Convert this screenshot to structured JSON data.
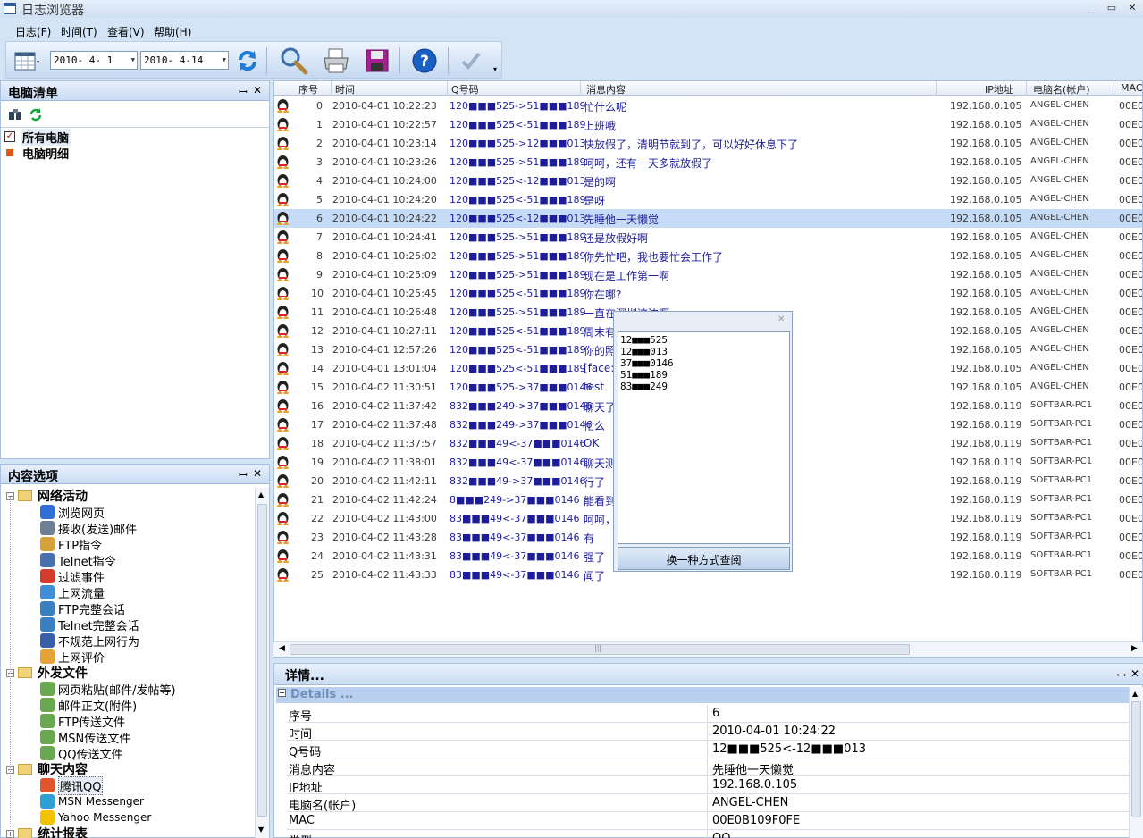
{
  "window": {
    "title": "日志浏览器"
  },
  "menu": [
    "日志(F)",
    "时间(T)",
    "查看(V)",
    "帮助(H)"
  ],
  "toolbar": {
    "date_from": "2010- 4- 1",
    "date_to": "2010- 4-14"
  },
  "pc_panel": {
    "title": "电脑清单",
    "items": [
      "所有电脑",
      "电脑明细"
    ]
  },
  "content_panel": {
    "title": "内容选项",
    "groups": [
      {
        "label": "网络活动",
        "items": [
          "浏览网页",
          "接收(发送)邮件",
          "FTP指令",
          "Telnet指令",
          "过滤事件",
          "上网流量",
          "FTP完整会话",
          "Telnet完整会话",
          "不规范上网行为",
          "上网评价"
        ]
      },
      {
        "label": "外发文件",
        "items": [
          "网页粘贴(邮件/发帖等)",
          "邮件正文(附件)",
          "FTP传送文件",
          "MSN传送文件",
          "QQ传送文件"
        ]
      },
      {
        "label": "聊天内容",
        "items": [
          "腾讯QQ",
          "MSN Messenger",
          "Yahoo Messenger"
        ]
      },
      {
        "label": "统计报表",
        "items": []
      }
    ]
  },
  "grid": {
    "columns": [
      "序号",
      "时间",
      "Q号码",
      "消息内容",
      "IP地址",
      "电脑名(帐户)",
      "MAC"
    ],
    "rows": [
      [
        "0",
        "2010-04-01 10:22:23",
        "120■■■525->51■■■189",
        "忙什么呢",
        "192.168.0.105",
        "ANGEL-CHEN",
        "00E0I"
      ],
      [
        "1",
        "2010-04-01 10:22:57",
        "120■■■525<-51■■■189",
        "上班哦",
        "192.168.0.105",
        "ANGEL-CHEN",
        "00E0I"
      ],
      [
        "2",
        "2010-04-01 10:23:14",
        "120■■■525->12■■■013",
        "快放假了，清明节就到了，可以好好休息下了",
        "192.168.0.105",
        "ANGEL-CHEN",
        "00E0I"
      ],
      [
        "3",
        "2010-04-01 10:23:26",
        "120■■■525->51■■■189",
        "呵呵，还有一天多就放假了",
        "192.168.0.105",
        "ANGEL-CHEN",
        "00E0I"
      ],
      [
        "4",
        "2010-04-01 10:24:00",
        "120■■■525<-12■■■013",
        "是的啊",
        "192.168.0.105",
        "ANGEL-CHEN",
        "00E0I"
      ],
      [
        "5",
        "2010-04-01 10:24:20",
        "120■■■525<-51■■■189",
        "是呀",
        "192.168.0.105",
        "ANGEL-CHEN",
        "00E0I"
      ],
      [
        "6",
        "2010-04-01 10:24:22",
        "120■■■525<-12■■■013",
        "先睡他一天懒觉",
        "192.168.0.105",
        "ANGEL-CHEN",
        "00E0I"
      ],
      [
        "7",
        "2010-04-01 10:24:41",
        "120■■■525->51■■■189",
        "还是放假好啊",
        "192.168.0.105",
        "ANGEL-CHEN",
        "00E0I"
      ],
      [
        "8",
        "2010-04-01 10:25:02",
        "120■■■525->51■■■189",
        "你先忙吧，我也要忙会工作了",
        "192.168.0.105",
        "ANGEL-CHEN",
        "00E0I"
      ],
      [
        "9",
        "2010-04-01 10:25:09",
        "120■■■525->51■■■189",
        "现在是工作第一啊",
        "192.168.0.105",
        "ANGEL-CHEN",
        "00E0I"
      ],
      [
        "10",
        "2010-04-01 10:25:45",
        "120■■■525<-51■■■189",
        "你在哪?",
        "192.168.0.105",
        "ANGEL-CHEN",
        "00E0I"
      ],
      [
        "11",
        "2010-04-01 10:26:48",
        "120■■■525->51■■■189",
        "一直在深圳这边啊",
        "192.168.0.105",
        "ANGEL-CHEN",
        "00E0I"
      ],
      [
        "12",
        "2010-04-01 10:27:11",
        "120■■■525<-51■■■189",
        "周末有",
        "192.168.0.105",
        "ANGEL-CHEN",
        "00E0I"
      ],
      [
        "13",
        "2010-04-01 12:57:26",
        "120■■■525<-51■■■189",
        "你的照",
        "192.168.0.105",
        "ANGEL-CHEN",
        "00E0I"
      ],
      [
        "14",
        "2010-04-01 13:01:04",
        "120■■■525<-51■■■189",
        "[face:",
        "192.168.0.105",
        "ANGEL-CHEN",
        "00E0I"
      ],
      [
        "15",
        "2010-04-02 11:30:51",
        "120■■■525->37■■■0146",
        "test",
        "192.168.0.105",
        "ANGEL-CHEN",
        "00E0I"
      ],
      [
        "16",
        "2010-04-02 11:37:42",
        "832■■■249->37■■■0146",
        "聊天了",
        "192.168.0.119",
        "SOFTBAR-PC1",
        "00E0I"
      ],
      [
        "17",
        "2010-04-02 11:37:48",
        "832■■■249->37■■■0146",
        "忙么",
        "192.168.0.119",
        "SOFTBAR-PC1",
        "00E0I"
      ],
      [
        "18",
        "2010-04-02 11:37:57",
        "832■■■49<-37■■■0146",
        "OK",
        "192.168.0.119",
        "SOFTBAR-PC1",
        "00E0I"
      ],
      [
        "19",
        "2010-04-02 11:38:01",
        "832■■■49<-37■■■0146",
        "聊天测",
        "192.168.0.119",
        "SOFTBAR-PC1",
        "00E0I"
      ],
      [
        "20",
        "2010-04-02 11:42:11",
        "832■■■49->37■■■0146",
        "行了",
        "192.168.0.119",
        "SOFTBAR-PC1",
        "00E0I"
      ],
      [
        "21",
        "2010-04-02 11:42:24",
        "8■■■249->37■■■0146",
        "能看到",
        "192.168.0.119",
        "SOFTBAR-PC1",
        "00E0I"
      ],
      [
        "22",
        "2010-04-02 11:43:00",
        "83■■■49<-37■■■0146",
        "呵呵，",
        "192.168.0.119",
        "SOFTBAR-PC1",
        "00E0I"
      ],
      [
        "23",
        "2010-04-02 11:43:28",
        "83■■■49<-37■■■0146",
        "有",
        "192.168.0.119",
        "SOFTBAR-PC1",
        "00E0I"
      ],
      [
        "24",
        "2010-04-02 11:43:31",
        "83■■■49<-37■■■0146",
        "强了",
        "192.168.0.119",
        "SOFTBAR-PC1",
        "00E0I"
      ],
      [
        "25",
        "2010-04-02 11:43:33",
        "83■■■49<-37■■■0146",
        "闻了",
        "192.168.0.119",
        "SOFTBAR-PC1",
        "00E0I"
      ]
    ],
    "selected_index": 6
  },
  "popup": {
    "items": [
      "12■■■525",
      "12■■■013",
      "37■■■0146",
      "51■■■189",
      "83■■■249"
    ],
    "button": "换一种方式查阅"
  },
  "details": {
    "title": "详情...",
    "group": "Details ...",
    "rows": [
      [
        "序号",
        "6"
      ],
      [
        "时间",
        "2010-04-01 10:24:22"
      ],
      [
        "Q号码",
        "12■■■525<-12■■■013"
      ],
      [
        "消息内容",
        "先睡他一天懒觉"
      ],
      [
        "IP地址",
        "192.168.0.105"
      ],
      [
        "电脑名(帐户)",
        "ANGEL-CHEN"
      ],
      [
        "MAC",
        "00E0B109F0FE"
      ],
      [
        "类型",
        "QQ"
      ]
    ]
  }
}
